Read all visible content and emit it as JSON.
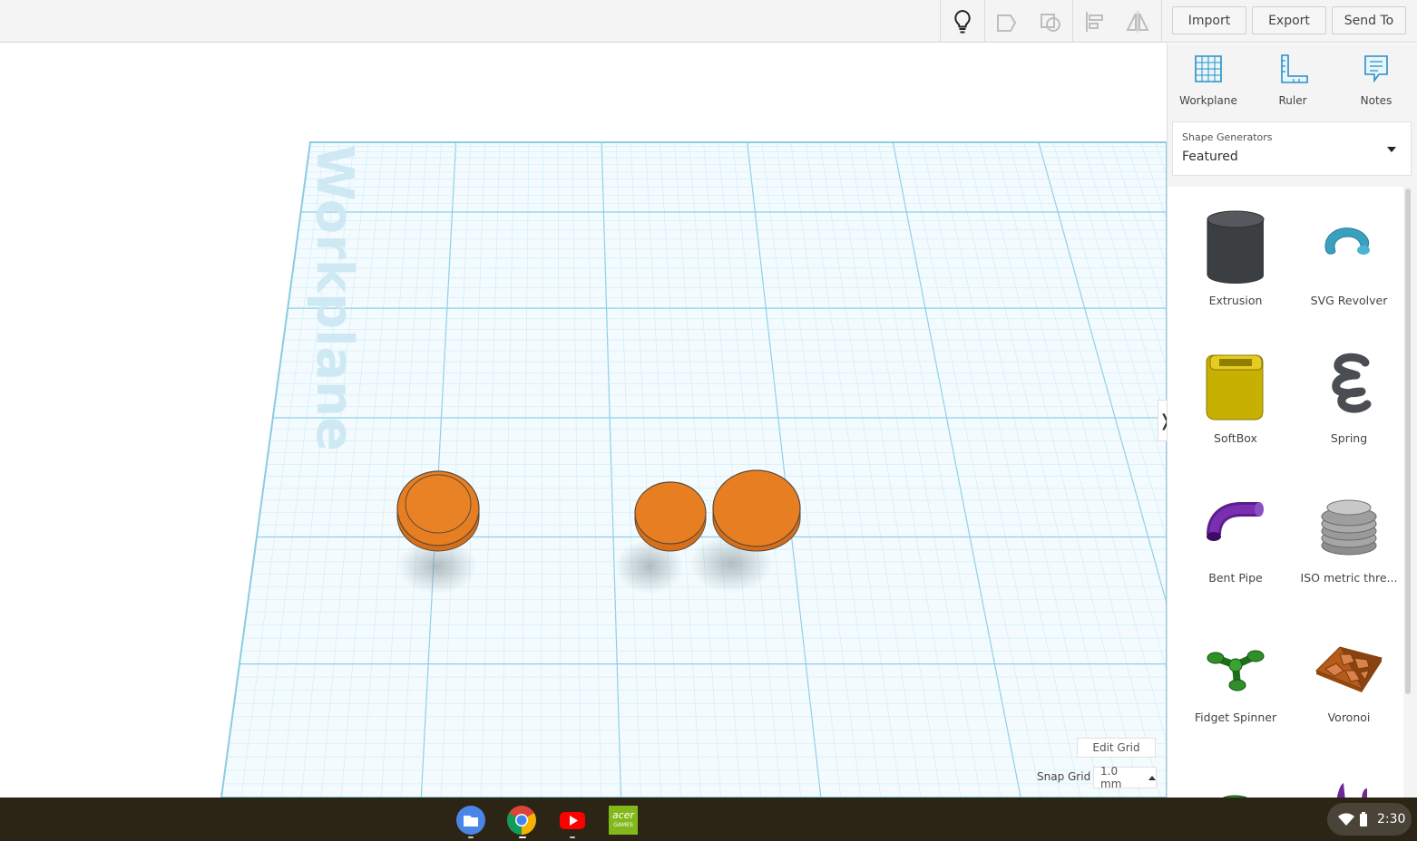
{
  "toolbar": {
    "icons": [
      "lightbulb-icon",
      "group-icon",
      "ungroup-icon",
      "align-icon",
      "mirror-icon"
    ],
    "import_label": "Import",
    "export_label": "Export",
    "send_to_label": "Send To"
  },
  "viewport": {
    "workplane_watermark": "Workplane",
    "edit_grid_label": "Edit Grid",
    "snap_grid_label": "Snap Grid",
    "snap_grid_value": "1.0 mm",
    "objects": [
      "orange-cylinder",
      "orange-cylinder",
      "orange-cylinder"
    ],
    "object_color": "#e77f22",
    "grid_color": "#a8dcee"
  },
  "panel": {
    "collapse_glyph": "❭",
    "tools": [
      {
        "label": "Workplane",
        "icon": "workplane-icon"
      },
      {
        "label": "Ruler",
        "icon": "ruler-icon"
      },
      {
        "label": "Notes",
        "icon": "notes-icon"
      }
    ],
    "shape_generators": {
      "caption": "Shape Generators",
      "value": "Featured"
    },
    "shapes": [
      {
        "label": "Extrusion",
        "icon": "extrusion-icon"
      },
      {
        "label": "SVG Revolver",
        "icon": "svg-revolver-icon"
      },
      {
        "label": "SoftBox",
        "icon": "softbox-icon"
      },
      {
        "label": "Spring",
        "icon": "spring-icon"
      },
      {
        "label": "Bent Pipe",
        "icon": "bent-pipe-icon"
      },
      {
        "label": "ISO metric thre...",
        "icon": "iso-thread-icon"
      },
      {
        "label": "Fidget Spinner",
        "icon": "fidget-spinner-icon"
      },
      {
        "label": "Voronoi",
        "icon": "voronoi-icon"
      }
    ]
  },
  "taskbar": {
    "apps": [
      "files-icon",
      "chrome-icon",
      "youtube-icon",
      "acer-games-icon"
    ],
    "acer_games_text": "acer",
    "acer_games_sub": "GAMES",
    "time": "2:30"
  }
}
